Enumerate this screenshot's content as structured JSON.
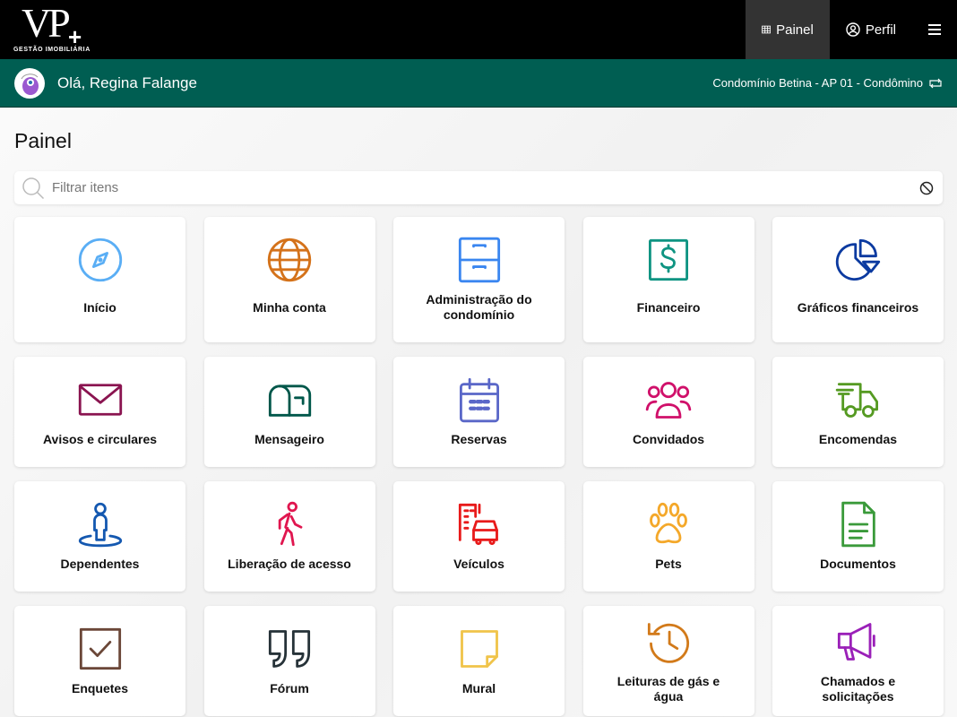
{
  "brand": {
    "logo_text": "VP+",
    "logo_subtitle": "GESTÃO IMOBILIÁRIA"
  },
  "nav": {
    "painel": "Painel",
    "perfil": "Perfil"
  },
  "greeting": "Olá, Regina Falange",
  "condominium": "Condomínio Betina - AP 01 - Condômino",
  "page_title": "Painel",
  "search": {
    "placeholder": "Filtrar itens",
    "value": ""
  },
  "items": [
    {
      "label": "Início",
      "icon": "compass-icon",
      "color": "#5aaef5"
    },
    {
      "label": "Minha conta",
      "icon": "globe-icon",
      "color": "#d4721a"
    },
    {
      "label": "Administração do condomínio",
      "icon": "file-cabinet-icon",
      "color": "#3a86f0"
    },
    {
      "label": "Financeiro",
      "icon": "dollar-icon",
      "color": "#0f9482"
    },
    {
      "label": "Gráficos financeiros",
      "icon": "pie-chart-icon",
      "color": "#0b3aa0"
    },
    {
      "label": "Avisos e circulares",
      "icon": "envelope-icon",
      "color": "#8a1450"
    },
    {
      "label": "Mensageiro",
      "icon": "mailbox-icon",
      "color": "#00574a"
    },
    {
      "label": "Reservas",
      "icon": "calendar-icon",
      "color": "#5a67c8"
    },
    {
      "label": "Convidados",
      "icon": "users-icon",
      "color": "#d0106a"
    },
    {
      "label": "Encomendas",
      "icon": "truck-icon",
      "color": "#559a22"
    },
    {
      "label": "Dependentes",
      "icon": "person-pin-icon",
      "color": "#1458b0"
    },
    {
      "label": "Liberação de acesso",
      "icon": "walking-icon",
      "color": "#e0164f"
    },
    {
      "label": "Veículos",
      "icon": "car-building-icon",
      "color": "#e81a1a"
    },
    {
      "label": "Pets",
      "icon": "paw-icon",
      "color": "#f4a82a"
    },
    {
      "label": "Documentos",
      "icon": "document-icon",
      "color": "#3a9a3a"
    },
    {
      "label": "Enquetes",
      "icon": "checkbox-icon",
      "color": "#6b4738"
    },
    {
      "label": "Fórum",
      "icon": "quote-icon",
      "color": "#263238"
    },
    {
      "label": "Mural",
      "icon": "sticky-note-icon",
      "color": "#f0c44a"
    },
    {
      "label": "Leituras de gás e água",
      "icon": "history-icon",
      "color": "#d27a1a"
    },
    {
      "label": "Chamados e solicitações",
      "icon": "megaphone-icon",
      "color": "#9a20b8"
    }
  ]
}
